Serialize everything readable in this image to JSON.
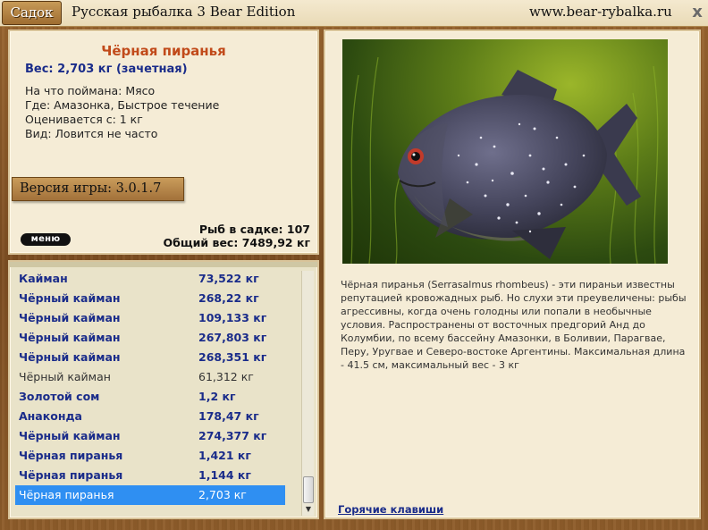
{
  "titlebar": {
    "sadok_label": "Садок",
    "app_title": "Русская рыбалка 3 Bear Edition",
    "site_url": "www.bear-rybalka.ru",
    "close_label": "x"
  },
  "fish": {
    "name": "Чёрная пиранья",
    "weight": "Вес: 2,703 кг (зачетная)",
    "caught_on": "На что поймана: Мясо",
    "location": "Где: Амазонка, Быстрое течение",
    "rated_from": "Оценивается с: 1 кг",
    "frequency": "Вид: Ловится не часто"
  },
  "version": "Версия игры: 3.0.1.7",
  "menu_label": "меню",
  "stats": {
    "fish_count": "Рыб в садке: 107",
    "total_weight": "Общий вес: 7489,92 кг"
  },
  "fish_list": [
    {
      "name": "Кайман",
      "weight": "73,522 кг",
      "state": "trophy"
    },
    {
      "name": "Чёрный кайман",
      "weight": "268,22 кг",
      "state": "trophy"
    },
    {
      "name": "Чёрный кайман",
      "weight": "109,133 кг",
      "state": "trophy"
    },
    {
      "name": "Чёрный кайман",
      "weight": "267,803 кг",
      "state": "trophy"
    },
    {
      "name": "Чёрный кайман",
      "weight": "268,351 кг",
      "state": "trophy"
    },
    {
      "name": "Чёрный кайман",
      "weight": "61,312 кг",
      "state": "normal"
    },
    {
      "name": "Золотой сом",
      "weight": "1,2 кг",
      "state": "trophy"
    },
    {
      "name": "Анаконда",
      "weight": "178,47 кг",
      "state": "trophy"
    },
    {
      "name": "Чёрный кайман",
      "weight": "274,377 кг",
      "state": "trophy"
    },
    {
      "name": "Чёрная пиранья",
      "weight": "1,421 кг",
      "state": "trophy"
    },
    {
      "name": "Чёрная пиранья",
      "weight": "1,144 кг",
      "state": "trophy"
    },
    {
      "name": "Чёрная пиранья",
      "weight": "2,703 кг",
      "state": "selected"
    }
  ],
  "description": "Чёрная пиранья (Serrasalmus rhombeus) - эти пираньи известны репутацией кровожадных рыб. Но слухи эти преувеличены: рыбы агрессивны, когда очень голодны или попали в необычные условия. Распространены от восточных предгорий Анд до Колумбии, по всему бассейну Амазонки, в Боливии, Парагвае, Перу,  Уругвае и Северо-востоке Аргентины. Максимальная длина - 41.5 см, максимальный вес - 3 кг",
  "hotkeys_label": "Горячие клавиши",
  "colors": {
    "trophy_text": "#1a2c8a",
    "fish_name": "#c14a1a",
    "selection": "#2f8ff2",
    "parchment": "#f5ecd6"
  }
}
